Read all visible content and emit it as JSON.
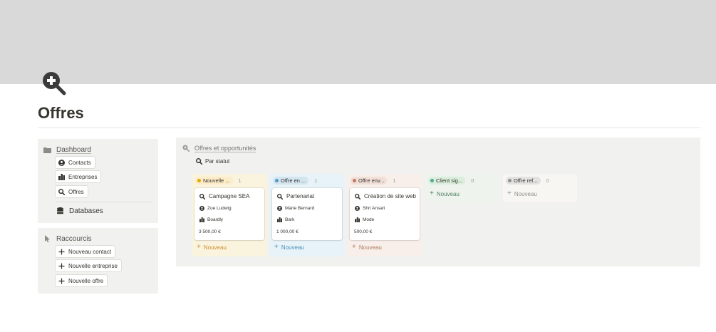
{
  "page": {
    "title": "Offres",
    "icon": "magnifier-plus-icon",
    "cover_color": "#d9d9d9"
  },
  "nav_panel": {
    "dashboard_label": "Dashboard",
    "buttons": [
      {
        "label": "Contacts",
        "icon": "user-circle-icon"
      },
      {
        "label": "Entreprises",
        "icon": "building-icon"
      },
      {
        "label": "Offres",
        "icon": "search-icon"
      }
    ],
    "databases_label": "Databases"
  },
  "shortcuts_panel": {
    "title": "Raccourcis",
    "buttons": [
      {
        "label": "Nouveau contact",
        "icon": "plus-icon"
      },
      {
        "label": "Nouvelle entreprise",
        "icon": "plus-icon"
      },
      {
        "label": "Nouvelle offre",
        "icon": "plus-icon"
      }
    ]
  },
  "board": {
    "title": "Offres et opportunités",
    "view_label": "Par statut",
    "new_label": "Nouveau",
    "columns": [
      {
        "status": "Nouvelle ...",
        "count": "1",
        "colors": {
          "bg": "#faf3dd",
          "tag": "#fdecc8",
          "dot": "#dfab01",
          "accent": "#cb912f"
        },
        "card": {
          "title": "Campagne SEA",
          "contact": "Zoe Ludwig",
          "company": "Boardly",
          "amount": "3 500,00 €"
        }
      },
      {
        "status": "Offre en ...",
        "count": "1",
        "colors": {
          "bg": "#e7f3f8",
          "tag": "#d3e5ef",
          "dot": "#529cca",
          "accent": "#4b8fb8"
        },
        "card": {
          "title": "Partenariat",
          "contact": "Marie Bernard",
          "company": "Bark",
          "amount": "1 000,00 €"
        }
      },
      {
        "status": "Offre env...",
        "count": "1",
        "colors": {
          "bg": "#f8efeb",
          "tag": "#f1dfd8",
          "dot": "#c07a61",
          "accent": "#b07a5e"
        },
        "card": {
          "title": "Création de site web",
          "contact": "Shri Ansari",
          "company": "Mode",
          "amount": "500,00 €"
        }
      },
      {
        "status": "Client sig...",
        "count": "0",
        "colors": {
          "bg": "#eef3ed",
          "tag": "#dbeddb",
          "dot": "#4dab9a",
          "accent": "#548164"
        }
      },
      {
        "status": "Offre ref...",
        "count": "0",
        "colors": {
          "bg": "#f7f6f3",
          "tag": "#e3e2e0",
          "dot": "#91918e",
          "accent": "#91918e"
        }
      }
    ]
  }
}
